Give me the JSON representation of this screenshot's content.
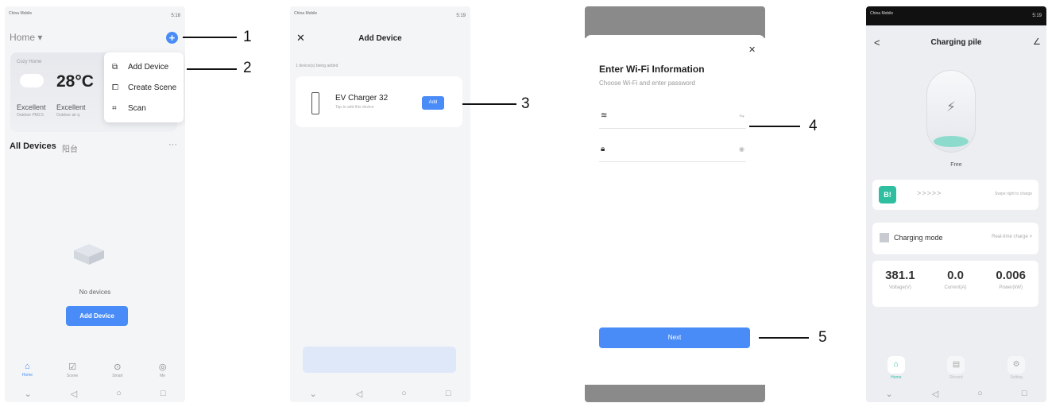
{
  "status": {
    "carrier": "China Mobile",
    "time_a": "5:18",
    "time_b": "5:19"
  },
  "screen1": {
    "home_title": "Home ▾",
    "plus_label": "+",
    "weather": {
      "location": "Cozy Home",
      "temperature": "28°C",
      "air1_value": "Excellent",
      "air1_label": "Outdoor PM2.5",
      "air2_value": "Excellent",
      "air2_label": "Outdoor air q"
    },
    "menu": [
      {
        "label": "Add Device",
        "icon": "add-device-icon"
      },
      {
        "label": "Create Scene",
        "icon": "create-scene-icon"
      },
      {
        "label": "Scan",
        "icon": "scan-icon"
      }
    ],
    "all_devices": "All Devices",
    "room": "阳台",
    "more": "···",
    "no_devices": "No devices",
    "add_device_button": "Add Device",
    "tabs": [
      {
        "label": "Home",
        "glyph": "⌂"
      },
      {
        "label": "Scene",
        "glyph": "☑"
      },
      {
        "label": "Smart",
        "glyph": "⊙"
      },
      {
        "label": "Me",
        "glyph": "◎"
      }
    ]
  },
  "screen2": {
    "close": "✕",
    "title": "Add Device",
    "adding_status": "1 device(s) being added",
    "device_name": "EV Charger 32",
    "device_sub": "Tap to add this device",
    "add_button": "Add"
  },
  "screen3": {
    "close": "✕",
    "title": "Enter Wi-Fi Information",
    "subtitle": "Choose Wi-Fi and enter password",
    "next_button": "Next"
  },
  "screen4": {
    "back": "<",
    "title": "Charging pile",
    "edit": "∠",
    "state": "Free",
    "swipe_arrows": ">>>>>",
    "swipe_hint": "Swipe right to charge",
    "knob": "B!",
    "mode_label": "Charging mode",
    "mode_value": "Real-time charge >",
    "metrics": [
      {
        "value": "381.1",
        "label": "Voltage(V)"
      },
      {
        "value": "0.0",
        "label": "Current(A)"
      },
      {
        "value": "0.006",
        "label": "Power(kW)"
      }
    ],
    "tabs": [
      {
        "label": "Home",
        "glyph": "⌂"
      },
      {
        "label": "Record",
        "glyph": "▤"
      },
      {
        "label": "Setting",
        "glyph": "⚙"
      }
    ]
  },
  "callouts": [
    "1",
    "2",
    "3",
    "4",
    "5"
  ],
  "colors": {
    "accent": "#4a8cf7",
    "teal": "#2fbfa0"
  }
}
